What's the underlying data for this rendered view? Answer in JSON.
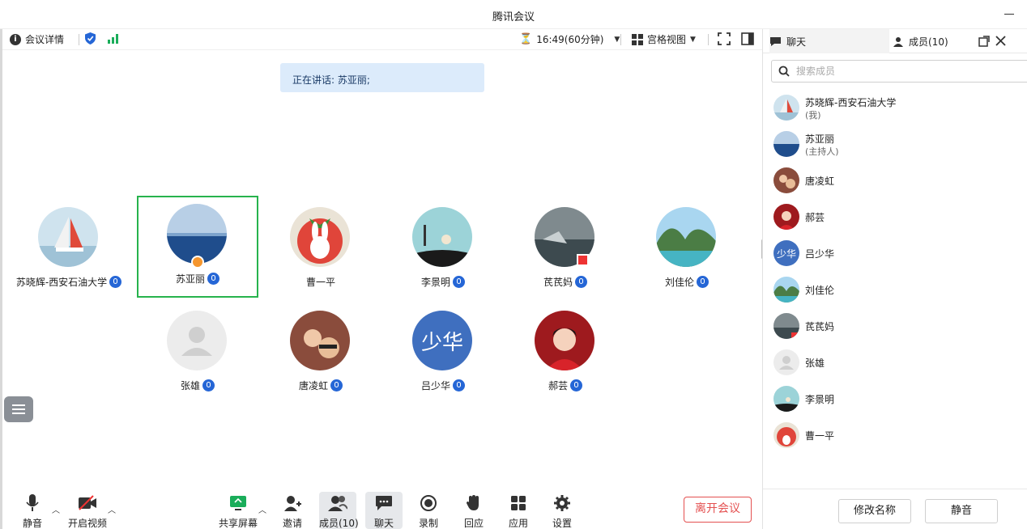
{
  "window": {
    "title": "腾讯会议"
  },
  "toolbar": {
    "meeting_details": "会议详情",
    "timer": "16:49(60分钟)",
    "view_mode": "宫格视图",
    "colors": {
      "shield": "#2566d6",
      "signal": "#1aad5a"
    }
  },
  "speaking": {
    "text": "正在讲话: 苏亚丽;"
  },
  "participants": [
    {
      "name": "苏晓辉-西安石油大学",
      "avatar": "sailboat"
    },
    {
      "name": "苏亚丽",
      "avatar": "sea",
      "host": true,
      "active": true
    },
    {
      "name": "曹一平",
      "avatar": "strawberry-bunny"
    },
    {
      "name": "李景明",
      "avatar": "painting"
    },
    {
      "name": "芪芪妈",
      "avatar": "beach-flag"
    },
    {
      "name": "刘佳伦",
      "avatar": "island"
    },
    {
      "name": "张雄",
      "avatar": "default-person"
    },
    {
      "name": "唐凌虹",
      "avatar": "selfie"
    },
    {
      "name": "吕少华",
      "avatar": "text-avatar",
      "avatar_text": "少华"
    },
    {
      "name": "郝芸",
      "avatar": "girl-red"
    }
  ],
  "bottom_bar": {
    "mute": "静音",
    "video": "开启视频",
    "share": "共享屏幕",
    "invite": "邀请",
    "members": "成员(10)",
    "chat": "聊天",
    "record": "录制",
    "react": "回应",
    "apps": "应用",
    "settings": "设置",
    "leave": "离开会议",
    "colors": {
      "leave": "#e45050",
      "share_icon": "#1aad5a"
    }
  },
  "panel": {
    "tab_chat": "聊天",
    "tab_members": "成员(10)",
    "search_placeholder": "搜索成员",
    "members": [
      {
        "name": "苏晓辉-西安石油大学",
        "role": "(我)",
        "avatar": "sailboat"
      },
      {
        "name": "苏亚丽",
        "role": "(主持人)",
        "avatar": "sea"
      },
      {
        "name": "唐凌虹",
        "avatar": "selfie"
      },
      {
        "name": "郝芸",
        "avatar": "girl-red"
      },
      {
        "name": "吕少华",
        "avatar": "text-avatar",
        "avatar_text": "少华"
      },
      {
        "name": "刘佳伦",
        "avatar": "island"
      },
      {
        "name": "芪芪妈",
        "avatar": "beach-flag"
      },
      {
        "name": "张雄",
        "avatar": "default-person"
      },
      {
        "name": "李景明",
        "avatar": "painting"
      },
      {
        "name": "曹一平",
        "avatar": "strawberry-bunny"
      }
    ],
    "rename_button": "修改名称",
    "mute_button": "静音"
  }
}
